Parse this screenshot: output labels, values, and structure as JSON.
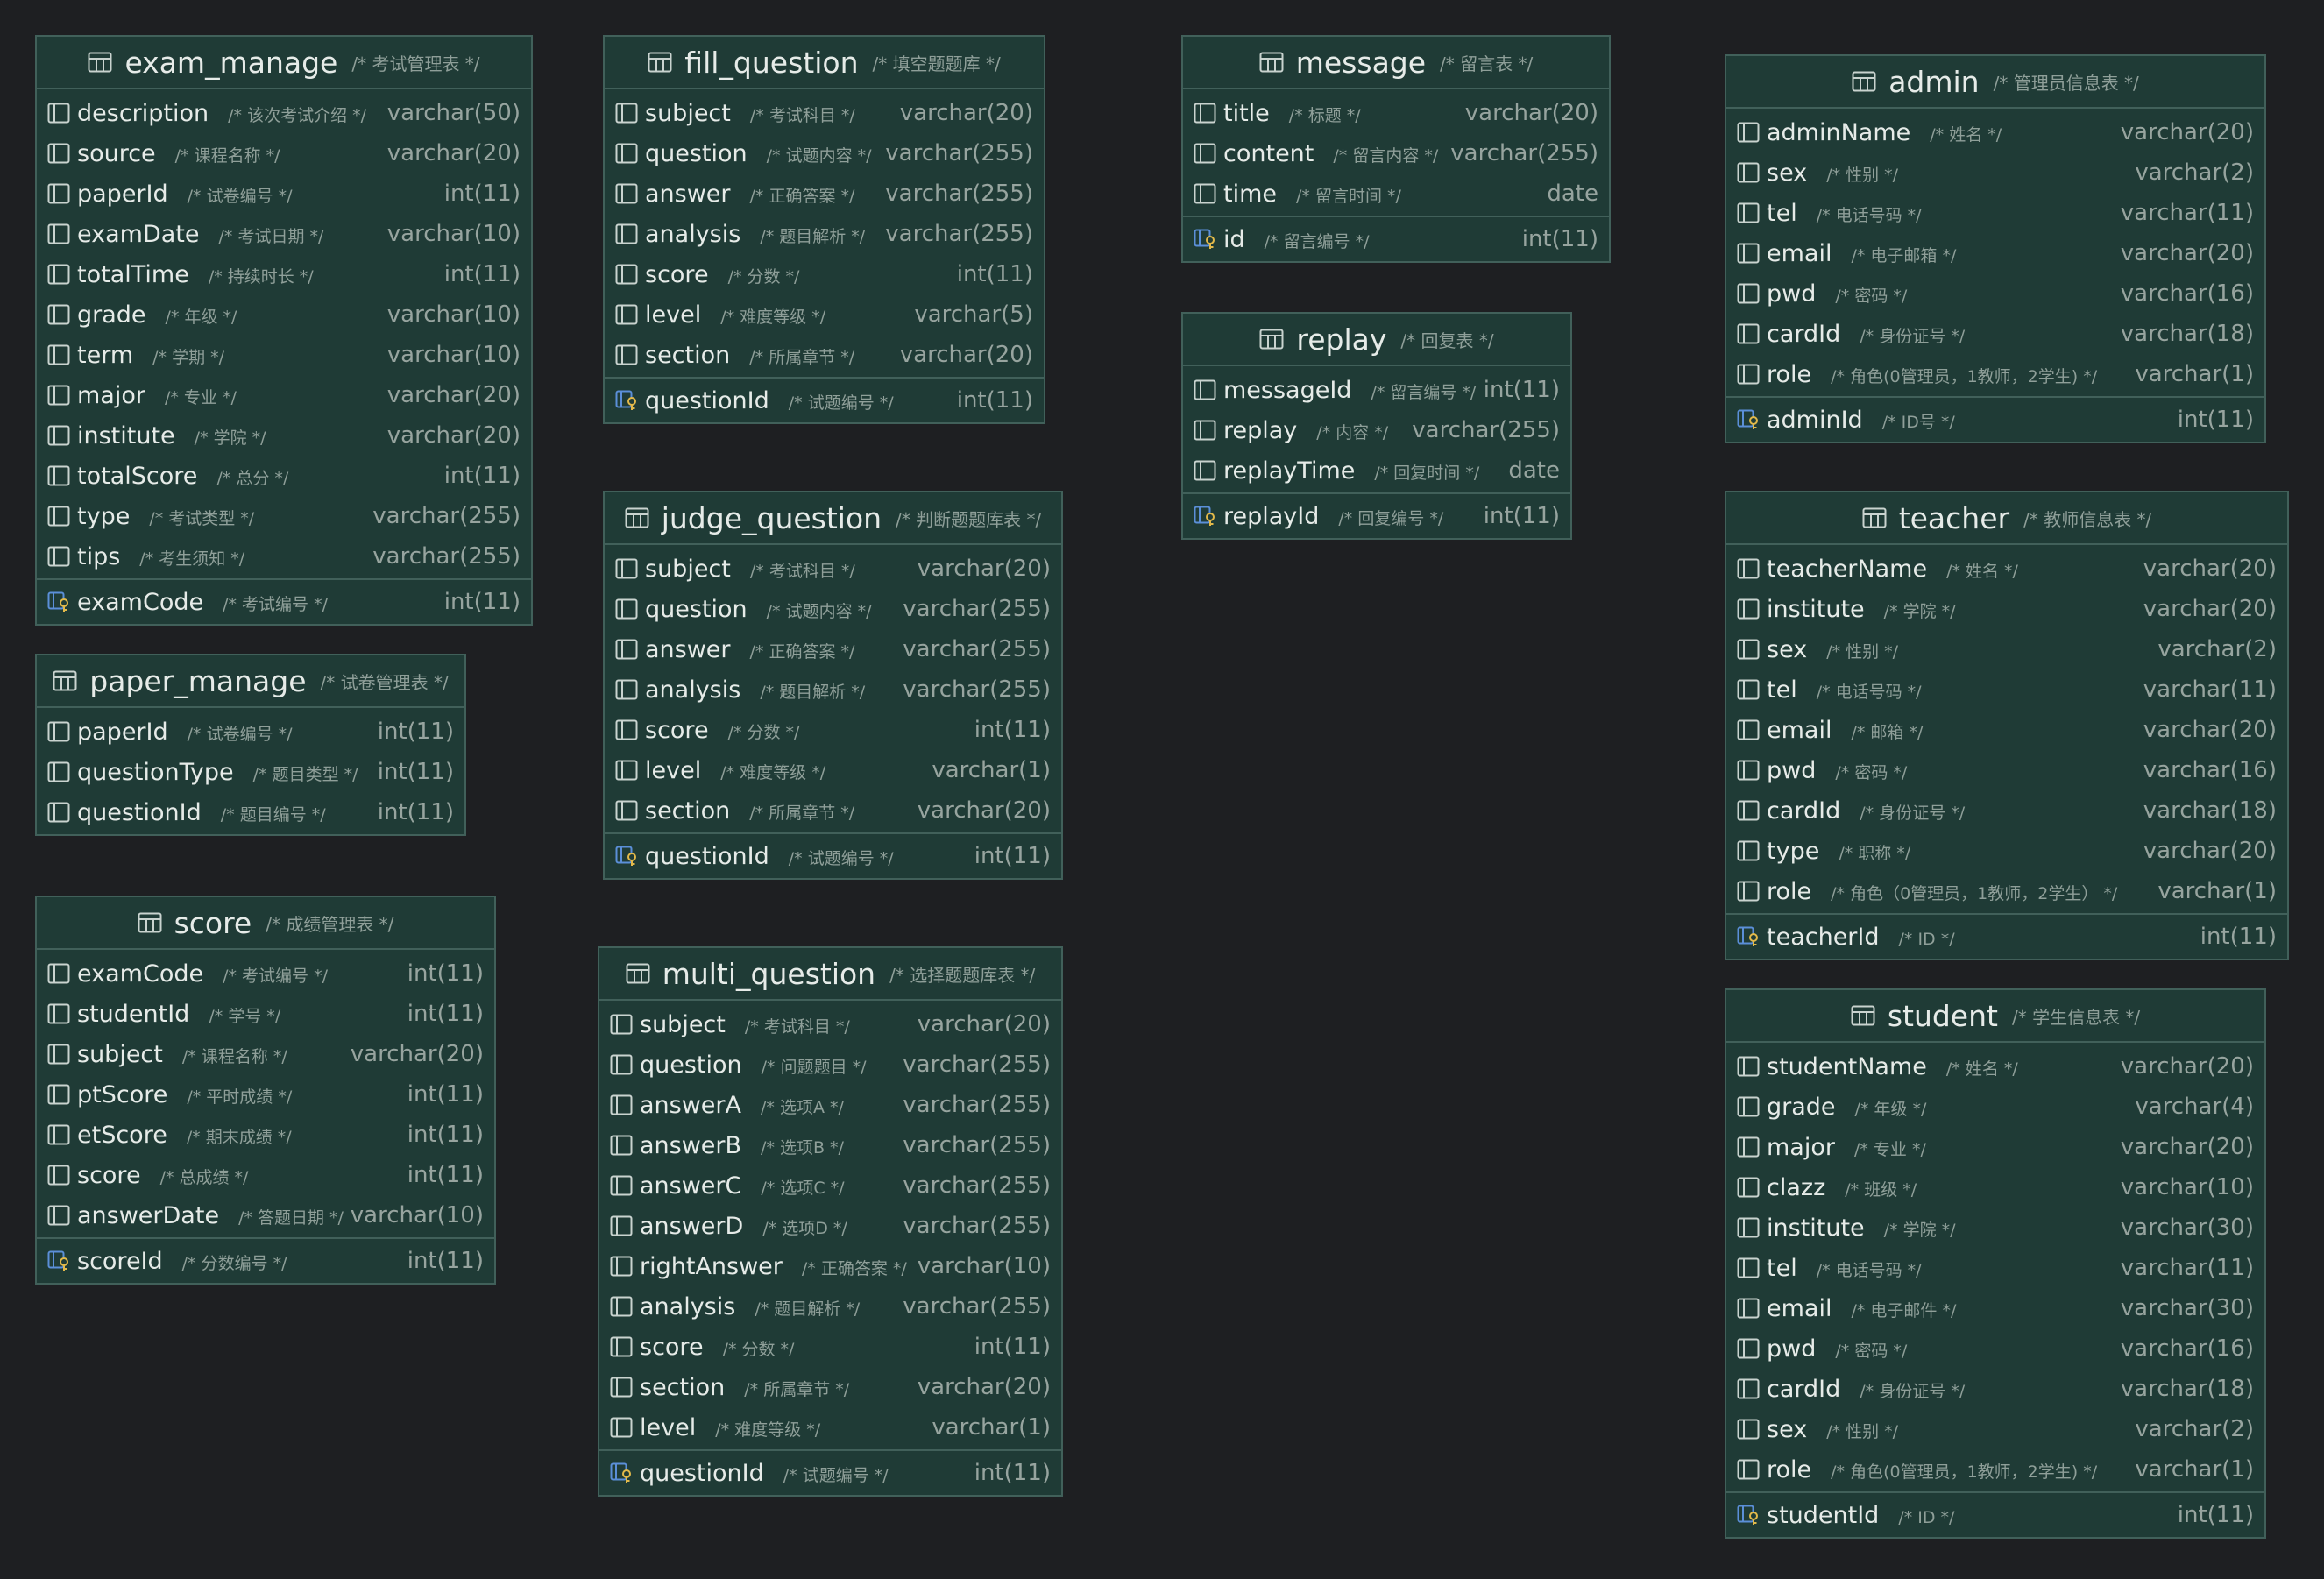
{
  "tables": [
    {
      "name": "exam_manage",
      "comment": "/* 考试管理表 */",
      "columns": [
        {
          "name": "description",
          "comment": "/* 该次考试介绍 */",
          "type": "varchar(50)"
        },
        {
          "name": "source",
          "comment": "/* 课程名称 */",
          "type": "varchar(20)"
        },
        {
          "name": "paperId",
          "comment": "/* 试卷编号 */",
          "type": "int(11)"
        },
        {
          "name": "examDate",
          "comment": "/* 考试日期 */",
          "type": "varchar(10)"
        },
        {
          "name": "totalTime",
          "comment": "/* 持续时长 */",
          "type": "int(11)"
        },
        {
          "name": "grade",
          "comment": "/* 年级 */",
          "type": "varchar(10)"
        },
        {
          "name": "term",
          "comment": "/* 学期 */",
          "type": "varchar(10)"
        },
        {
          "name": "major",
          "comment": "/* 专业 */",
          "type": "varchar(20)"
        },
        {
          "name": "institute",
          "comment": "/* 学院 */",
          "type": "varchar(20)"
        },
        {
          "name": "totalScore",
          "comment": "/* 总分 */",
          "type": "int(11)"
        },
        {
          "name": "type",
          "comment": "/* 考试类型 */",
          "type": "varchar(255)"
        },
        {
          "name": "tips",
          "comment": "/* 考生须知 */",
          "type": "varchar(255)"
        }
      ],
      "pk": {
        "name": "examCode",
        "comment": "/* 考试编号 */",
        "type": "int(11)"
      }
    },
    {
      "name": "paper_manage",
      "comment": "/* 试卷管理表 */",
      "columns": [
        {
          "name": "paperId",
          "comment": "/* 试卷编号 */",
          "type": "int(11)"
        },
        {
          "name": "questionType",
          "comment": "/* 题目类型 */",
          "type": "int(11)"
        },
        {
          "name": "questionId",
          "comment": "/* 题目编号 */",
          "type": "int(11)"
        }
      ],
      "pk": null
    },
    {
      "name": "score",
      "comment": "/* 成绩管理表 */",
      "columns": [
        {
          "name": "examCode",
          "comment": "/* 考试编号 */",
          "type": "int(11)"
        },
        {
          "name": "studentId",
          "comment": "/* 学号 */",
          "type": "int(11)"
        },
        {
          "name": "subject",
          "comment": "/* 课程名称 */",
          "type": "varchar(20)"
        },
        {
          "name": "ptScore",
          "comment": "/* 平时成绩 */",
          "type": "int(11)"
        },
        {
          "name": "etScore",
          "comment": "/* 期末成绩 */",
          "type": "int(11)"
        },
        {
          "name": "score",
          "comment": "/* 总成绩 */",
          "type": "int(11)"
        },
        {
          "name": "answerDate",
          "comment": "/* 答题日期 */",
          "type": "varchar(10)"
        }
      ],
      "pk": {
        "name": "scoreId",
        "comment": "/* 分数编号 */",
        "type": "int(11)"
      }
    },
    {
      "name": "fill_question",
      "comment": "/* 填空题题库 */",
      "columns": [
        {
          "name": "subject",
          "comment": "/* 考试科目 */",
          "type": "varchar(20)"
        },
        {
          "name": "question",
          "comment": "/* 试题内容 */",
          "type": "varchar(255)"
        },
        {
          "name": "answer",
          "comment": "/* 正确答案 */",
          "type": "varchar(255)"
        },
        {
          "name": "analysis",
          "comment": "/* 题目解析 */",
          "type": "varchar(255)"
        },
        {
          "name": "score",
          "comment": "/* 分数 */",
          "type": "int(11)"
        },
        {
          "name": "level",
          "comment": "/* 难度等级 */",
          "type": "varchar(5)"
        },
        {
          "name": "section",
          "comment": "/* 所属章节 */",
          "type": "varchar(20)"
        }
      ],
      "pk": {
        "name": "questionId",
        "comment": "/* 试题编号 */",
        "type": "int(11)"
      }
    },
    {
      "name": "judge_question",
      "comment": "/* 判断题题库表 */",
      "columns": [
        {
          "name": "subject",
          "comment": "/* 考试科目 */",
          "type": "varchar(20)"
        },
        {
          "name": "question",
          "comment": "/* 试题内容 */",
          "type": "varchar(255)"
        },
        {
          "name": "answer",
          "comment": "/* 正确答案 */",
          "type": "varchar(255)"
        },
        {
          "name": "analysis",
          "comment": "/* 题目解析 */",
          "type": "varchar(255)"
        },
        {
          "name": "score",
          "comment": "/* 分数 */",
          "type": "int(11)"
        },
        {
          "name": "level",
          "comment": "/* 难度等级 */",
          "type": "varchar(1)"
        },
        {
          "name": "section",
          "comment": "/* 所属章节 */",
          "type": "varchar(20)"
        }
      ],
      "pk": {
        "name": "questionId",
        "comment": "/* 试题编号 */",
        "type": "int(11)"
      }
    },
    {
      "name": "multi_question",
      "comment": "/* 选择题题库表 */",
      "columns": [
        {
          "name": "subject",
          "comment": "/* 考试科目 */",
          "type": "varchar(20)"
        },
        {
          "name": "question",
          "comment": "/* 问题题目 */",
          "type": "varchar(255)"
        },
        {
          "name": "answerA",
          "comment": "/* 选项A */",
          "type": "varchar(255)"
        },
        {
          "name": "answerB",
          "comment": "/* 选项B */",
          "type": "varchar(255)"
        },
        {
          "name": "answerC",
          "comment": "/* 选项C */",
          "type": "varchar(255)"
        },
        {
          "name": "answerD",
          "comment": "/* 选项D */",
          "type": "varchar(255)"
        },
        {
          "name": "rightAnswer",
          "comment": "/* 正确答案 */",
          "type": "varchar(10)"
        },
        {
          "name": "analysis",
          "comment": "/* 题目解析 */",
          "type": "varchar(255)"
        },
        {
          "name": "score",
          "comment": "/* 分数 */",
          "type": "int(11)"
        },
        {
          "name": "section",
          "comment": "/* 所属章节 */",
          "type": "varchar(20)"
        },
        {
          "name": "level",
          "comment": "/* 难度等级 */",
          "type": "varchar(1)"
        }
      ],
      "pk": {
        "name": "questionId",
        "comment": "/* 试题编号 */",
        "type": "int(11)"
      }
    },
    {
      "name": "message",
      "comment": "/* 留言表 */",
      "columns": [
        {
          "name": "title",
          "comment": "/* 标题 */",
          "type": "varchar(20)"
        },
        {
          "name": "content",
          "comment": "/* 留言内容 */",
          "type": "varchar(255)"
        },
        {
          "name": "time",
          "comment": "/* 留言时间 */",
          "type": "date"
        }
      ],
      "pk": {
        "name": "id",
        "comment": "/* 留言编号 */",
        "type": "int(11)"
      }
    },
    {
      "name": "replay",
      "comment": "/* 回复表 */",
      "columns": [
        {
          "name": "messageId",
          "comment": "/* 留言编号 */",
          "type": "int(11)"
        },
        {
          "name": "replay",
          "comment": "/* 内容 */",
          "type": "varchar(255)"
        },
        {
          "name": "replayTime",
          "comment": "/* 回复时间 */",
          "type": "date"
        }
      ],
      "pk": {
        "name": "replayId",
        "comment": "/* 回复编号 */",
        "type": "int(11)"
      }
    },
    {
      "name": "admin",
      "comment": "/* 管理员信息表 */",
      "columns": [
        {
          "name": "adminName",
          "comment": "/* 姓名 */",
          "type": "varchar(20)"
        },
        {
          "name": "sex",
          "comment": "/* 性别 */",
          "type": "varchar(2)"
        },
        {
          "name": "tel",
          "comment": "/* 电话号码 */",
          "type": "varchar(11)"
        },
        {
          "name": "email",
          "comment": "/* 电子邮箱 */",
          "type": "varchar(20)"
        },
        {
          "name": "pwd",
          "comment": "/* 密码 */",
          "type": "varchar(16)"
        },
        {
          "name": "cardId",
          "comment": "/* 身份证号 */",
          "type": "varchar(18)"
        },
        {
          "name": "role",
          "comment": "/* 角色(0管理员，1教师，2学生) */",
          "type": "varchar(1)"
        }
      ],
      "pk": {
        "name": "adminId",
        "comment": "/* ID号 */",
        "type": "int(11)"
      }
    },
    {
      "name": "teacher",
      "comment": "/* 教师信息表 */",
      "columns": [
        {
          "name": "teacherName",
          "comment": "/* 姓名 */",
          "type": "varchar(20)"
        },
        {
          "name": "institute",
          "comment": "/* 学院 */",
          "type": "varchar(20)"
        },
        {
          "name": "sex",
          "comment": "/* 性别 */",
          "type": "varchar(2)"
        },
        {
          "name": "tel",
          "comment": "/* 电话号码 */",
          "type": "varchar(11)"
        },
        {
          "name": "email",
          "comment": "/* 邮箱 */",
          "type": "varchar(20)"
        },
        {
          "name": "pwd",
          "comment": "/* 密码 */",
          "type": "varchar(16)"
        },
        {
          "name": "cardId",
          "comment": "/* 身份证号 */",
          "type": "varchar(18)"
        },
        {
          "name": "type",
          "comment": "/* 职称 */",
          "type": "varchar(20)"
        },
        {
          "name": "role",
          "comment": "/* 角色（0管理员，1教师，2学生） */",
          "type": "varchar(1)"
        }
      ],
      "pk": {
        "name": "teacherId",
        "comment": "/* ID */",
        "type": "int(11)"
      }
    },
    {
      "name": "student",
      "comment": "/* 学生信息表 */",
      "columns": [
        {
          "name": "studentName",
          "comment": "/* 姓名 */",
          "type": "varchar(20)"
        },
        {
          "name": "grade",
          "comment": "/* 年级 */",
          "type": "varchar(4)"
        },
        {
          "name": "major",
          "comment": "/* 专业 */",
          "type": "varchar(20)"
        },
        {
          "name": "clazz",
          "comment": "/* 班级 */",
          "type": "varchar(10)"
        },
        {
          "name": "institute",
          "comment": "/* 学院 */",
          "type": "varchar(30)"
        },
        {
          "name": "tel",
          "comment": "/* 电话号码 */",
          "type": "varchar(11)"
        },
        {
          "name": "email",
          "comment": "/* 电子邮件 */",
          "type": "varchar(30)"
        },
        {
          "name": "pwd",
          "comment": "/* 密码 */",
          "type": "varchar(16)"
        },
        {
          "name": "cardId",
          "comment": "/* 身份证号 */",
          "type": "varchar(18)"
        },
        {
          "name": "sex",
          "comment": "/* 性别 */",
          "type": "varchar(2)"
        },
        {
          "name": "role",
          "comment": "/* 角色(0管理员，1教师，2学生) */",
          "type": "varchar(1)"
        }
      ],
      "pk": {
        "name": "studentId",
        "comment": "/* ID */",
        "type": "int(11)"
      }
    }
  ]
}
